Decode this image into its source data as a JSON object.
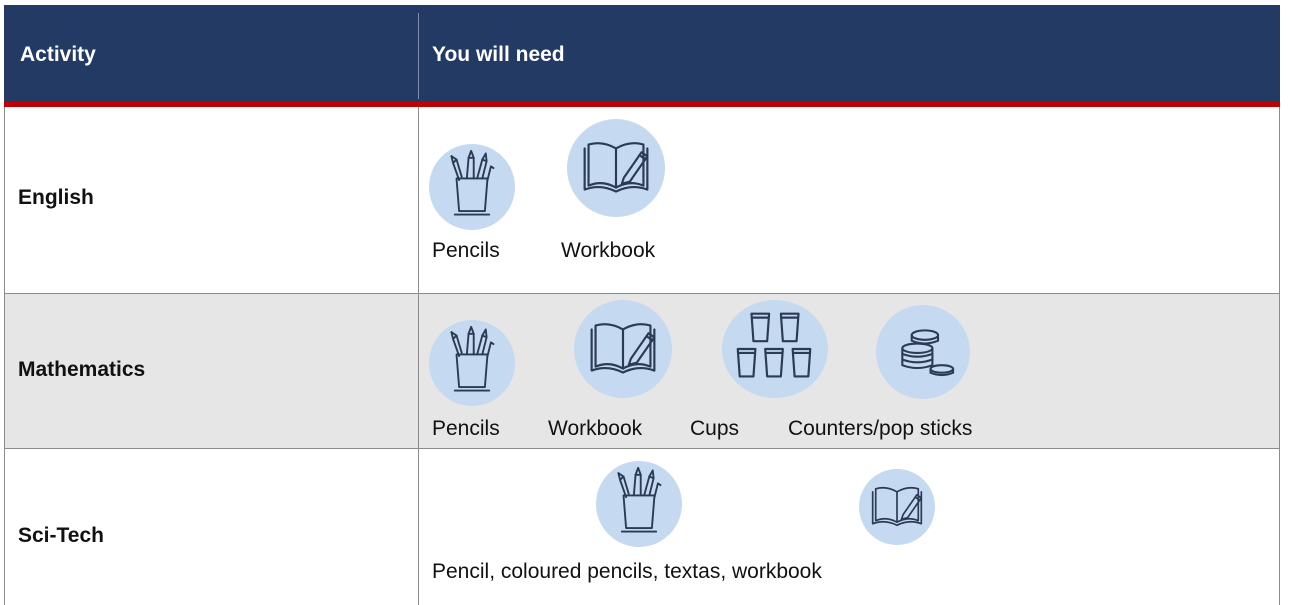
{
  "header": {
    "col1": "Activity",
    "col2": "You will need"
  },
  "rows": [
    {
      "subject": "English",
      "items": [
        {
          "label": "Pencils",
          "icon": "pencil-cup-icon"
        },
        {
          "label": "Workbook",
          "icon": "workbook-icon"
        }
      ]
    },
    {
      "subject": "Mathematics",
      "items": [
        {
          "label": "Pencils",
          "icon": "pencil-cup-icon"
        },
        {
          "label": "Workbook",
          "icon": "workbook-icon"
        },
        {
          "label": "Cups",
          "icon": "cups-icon"
        },
        {
          "label": "Counters/pop sticks",
          "icon": "counters-icon"
        }
      ]
    },
    {
      "subject": "Sci-Tech",
      "caption": "Pencil, coloured pencils, textas, workbook",
      "items": [
        {
          "icon": "pencil-cup-icon"
        },
        {
          "icon": "workbook-icon"
        }
      ]
    }
  ],
  "colors": {
    "header_bg": "#223a64",
    "accent_line": "#c00000",
    "icon_circle": "#c5d9f1",
    "shaded_row": "#e6e6e6"
  }
}
